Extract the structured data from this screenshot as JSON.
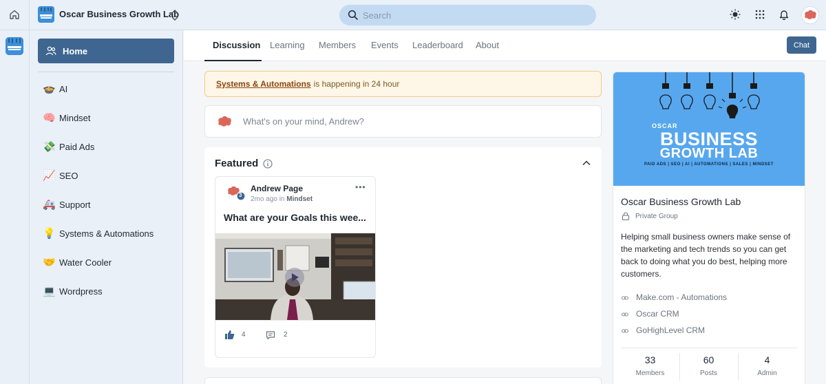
{
  "header": {
    "group_name": "Oscar Business Growth Lab",
    "search_placeholder": "Search"
  },
  "sidebar": {
    "home_label": "Home",
    "items": [
      {
        "emoji": "🍲",
        "label": "AI"
      },
      {
        "emoji": "🧠",
        "label": "Mindset"
      },
      {
        "emoji": "💸",
        "label": "Paid Ads"
      },
      {
        "emoji": "📈",
        "label": "SEO"
      },
      {
        "emoji": "🚑",
        "label": "Support"
      },
      {
        "emoji": "💡",
        "label": "Systems & Automations"
      },
      {
        "emoji": "🤝",
        "label": "Water Cooler"
      },
      {
        "emoji": "💻",
        "label": "Wordpress"
      }
    ]
  },
  "tabs": [
    "Discussion",
    "Learning",
    "Members",
    "Events",
    "Leaderboard",
    "About"
  ],
  "chat_label": "Chat",
  "banner": {
    "event_link": "Systems & Automations",
    "event_text": "is happening in 24 hour"
  },
  "composer": {
    "placeholder": "What's on your mind, Andrew?"
  },
  "featured": {
    "title": "Featured",
    "post": {
      "author": "Andrew Page",
      "badge_level": "3",
      "time": "2mo ago",
      "in_word": "in",
      "category": "Mindset",
      "title": "What are your Goals this wee...",
      "likes": "4",
      "comments": "2"
    }
  },
  "about_card": {
    "cover": {
      "brand": "OSCAR",
      "line1": "BUSINESS",
      "line2": "GROWTH LAB",
      "tagline": "PAID ADS | SEO | AI | AUTOMATIONS | SALES | MINDSET"
    },
    "title": "Oscar Business Growth Lab",
    "privacy": "Private Group",
    "description": "Helping small business owners make sense of the marketing and tech trends so you can get back to doing what you do best, helping more customers.",
    "links": [
      "Make.com - Automations",
      "Oscar CRM",
      "GoHighLevel CRM"
    ],
    "stats": [
      {
        "value": "33",
        "label": "Members"
      },
      {
        "value": "60",
        "label": "Posts"
      },
      {
        "value": "4",
        "label": "Admin"
      }
    ]
  },
  "colors": {
    "primary": "#3e6690",
    "topbar_bg": "#e9f0f8",
    "search_bg": "#c3daf3",
    "banner_bg": "#fef6e6",
    "cover_bg": "#57a7ee"
  }
}
